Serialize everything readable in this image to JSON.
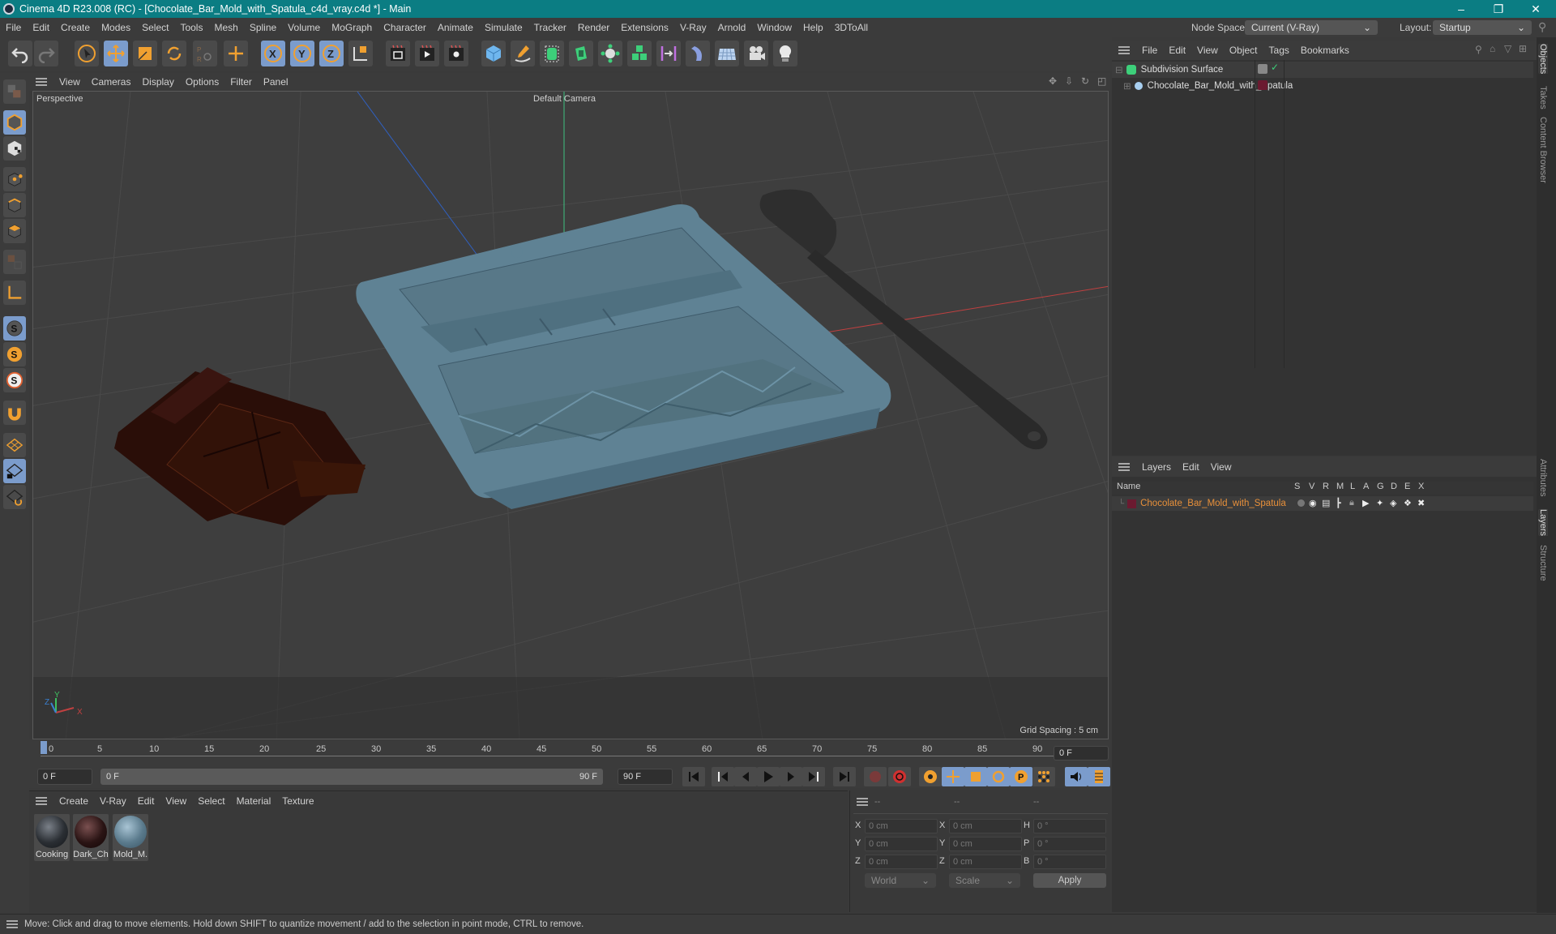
{
  "titlebar": {
    "title": "Cinema 4D R23.008 (RC) - [Chocolate_Bar_Mold_with_Spatula_c4d_vray.c4d *] - Main",
    "minimize": "–",
    "maximize": "❐",
    "close": "✕"
  },
  "menubar": {
    "items": [
      "File",
      "Edit",
      "Create",
      "Modes",
      "Select",
      "Tools",
      "Mesh",
      "Spline",
      "Volume",
      "MoGraph",
      "Character",
      "Animate",
      "Simulate",
      "Tracker",
      "Render",
      "Extensions",
      "V-Ray",
      "Arnold",
      "Window",
      "Help",
      "3DToAll"
    ],
    "node_space_label": "Node Space:",
    "node_space_value": "Current (V-Ray)",
    "layout_label": "Layout:",
    "layout_value": "Startup"
  },
  "toolbar": {
    "icons": [
      "undo-icon",
      "redo-icon",
      "select-icon",
      "move-icon",
      "scale-icon",
      "rotate-icon",
      "psr-icon",
      "move-plus-icon",
      "x-axis-icon",
      "y-axis-icon",
      "z-axis-icon",
      "coordinate-system-icon",
      "render-view-icon",
      "render-picture-viewer-icon",
      "render-settings-icon",
      "cube-icon",
      "pen-icon",
      "subdivision-icon",
      "extrude-icon",
      "cloner-icon",
      "array-icon",
      "symmetry-icon",
      "deformer-icon",
      "floor-icon",
      "camera-icon",
      "light-icon"
    ]
  },
  "left_toolbar": {
    "icons": [
      "make-editable-icon",
      "model-mode-icon",
      "texture-mode-icon",
      "point-mode-icon",
      "edge-mode-icon",
      "polygon-mode-icon",
      "uv-mode-icon",
      "axis-mode-icon",
      "snap-icon",
      "snap-settings-icon",
      "quantize-icon",
      "magnet-icon",
      "workplane-icon",
      "locked-workplane-icon",
      "workplane-align-icon"
    ]
  },
  "viewport": {
    "menu": [
      "View",
      "Cameras",
      "Display",
      "Options",
      "Filter",
      "Panel"
    ],
    "view_name": "Perspective",
    "camera_name": "Default Camera",
    "grid_spacing": "Grid Spacing : 5 cm",
    "axis_labels": {
      "x": "X",
      "y": "Y",
      "z": "Z"
    }
  },
  "timeline": {
    "ticks": [
      "0",
      "5",
      "10",
      "15",
      "20",
      "25",
      "30",
      "35",
      "40",
      "45",
      "50",
      "55",
      "60",
      "65",
      "70",
      "75",
      "80",
      "85",
      "90"
    ],
    "current_frame": "0 F",
    "start_frame": "0 F",
    "range_start": "0 F",
    "range_end": "90 F",
    "end_frame": "90 F",
    "right_frame": "0 F"
  },
  "material_panel": {
    "menu": [
      "Create",
      "V-Ray",
      "Edit",
      "View",
      "Select",
      "Material",
      "Texture"
    ],
    "materials": [
      {
        "label": "Cooking",
        "color": "#2a2e33"
      },
      {
        "label": "Dark_Ch",
        "color": "#2a1414"
      },
      {
        "label": "Mold_M.",
        "color": "#5a7a8c"
      }
    ]
  },
  "coordinates": {
    "headers": [
      "--",
      "--",
      "--"
    ],
    "rows": [
      {
        "a_label": "X",
        "a_val": "0 cm",
        "b_label": "X",
        "b_val": "0 cm",
        "c_label": "H",
        "c_val": "0 °"
      },
      {
        "a_label": "Y",
        "a_val": "0 cm",
        "b_label": "Y",
        "b_val": "0 cm",
        "c_label": "P",
        "c_val": "0 °"
      },
      {
        "a_label": "Z",
        "a_val": "0 cm",
        "b_label": "Z",
        "b_val": "0 cm",
        "c_label": "B",
        "c_val": "0 °"
      }
    ],
    "coord_system": "World",
    "mode": "Scale",
    "apply_label": "Apply"
  },
  "object_manager": {
    "menu": [
      "File",
      "Edit",
      "View",
      "Object",
      "Tags",
      "Bookmarks"
    ],
    "objects": [
      {
        "name": "Subdivision Surface",
        "level": 0
      },
      {
        "name": "Chocolate_Bar_Mold_with_Spatula",
        "level": 1,
        "layer_color": "#6b1a30"
      }
    ]
  },
  "layer_manager": {
    "menu": [
      "Layers",
      "Edit",
      "View"
    ],
    "columns": [
      "Name",
      "S",
      "V",
      "R",
      "M",
      "L",
      "A",
      "G",
      "D",
      "E",
      "X"
    ],
    "layers": [
      {
        "name": "Chocolate_Bar_Mold_with_Spatula",
        "color": "#6b1a30"
      }
    ]
  },
  "side_tabs": {
    "top": [
      "Objects",
      "Takes",
      "Content Browser"
    ],
    "bottom": [
      "Attributes",
      "Layers",
      "Structure"
    ]
  },
  "statusbar": {
    "text": "Move: Click and drag to move elements. Hold down SHIFT to quantize movement / add to the selection in point mode, CTRL to remove."
  },
  "colors": {
    "titlebar": "#0b7d83",
    "accent_orange": "#f0a030",
    "active_blue": "#7b9ccc",
    "layer_name": "#e8903a"
  }
}
